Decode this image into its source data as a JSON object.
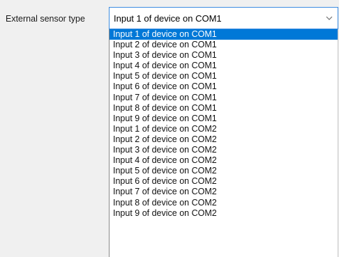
{
  "field": {
    "label": "External sensor type",
    "selected_value": "Input 1 of device on COM1"
  },
  "dropdown": {
    "arrow_icon": "chevron-down-icon",
    "selection_color": "#0078d7",
    "options": [
      "Input 1 of device on COM1",
      "Input 2 of device on COM1",
      "Input 3 of device on COM1",
      "Input 4 of device on COM1",
      "Input 5 of device on COM1",
      "Input 6 of device on COM1",
      "Input 7 of device on COM1",
      "Input 8 of device on COM1",
      "Input 9 of device on COM1",
      "Input 1 of device on COM2",
      "Input 2 of device on COM2",
      "Input 3 of device on COM2",
      "Input 4 of device on COM2",
      "Input 5 of device on COM2",
      "Input 6 of device on COM2",
      "Input 7 of device on COM2",
      "Input 8 of device on COM2",
      "Input 9 of device on COM2"
    ],
    "selected_index": 0
  }
}
